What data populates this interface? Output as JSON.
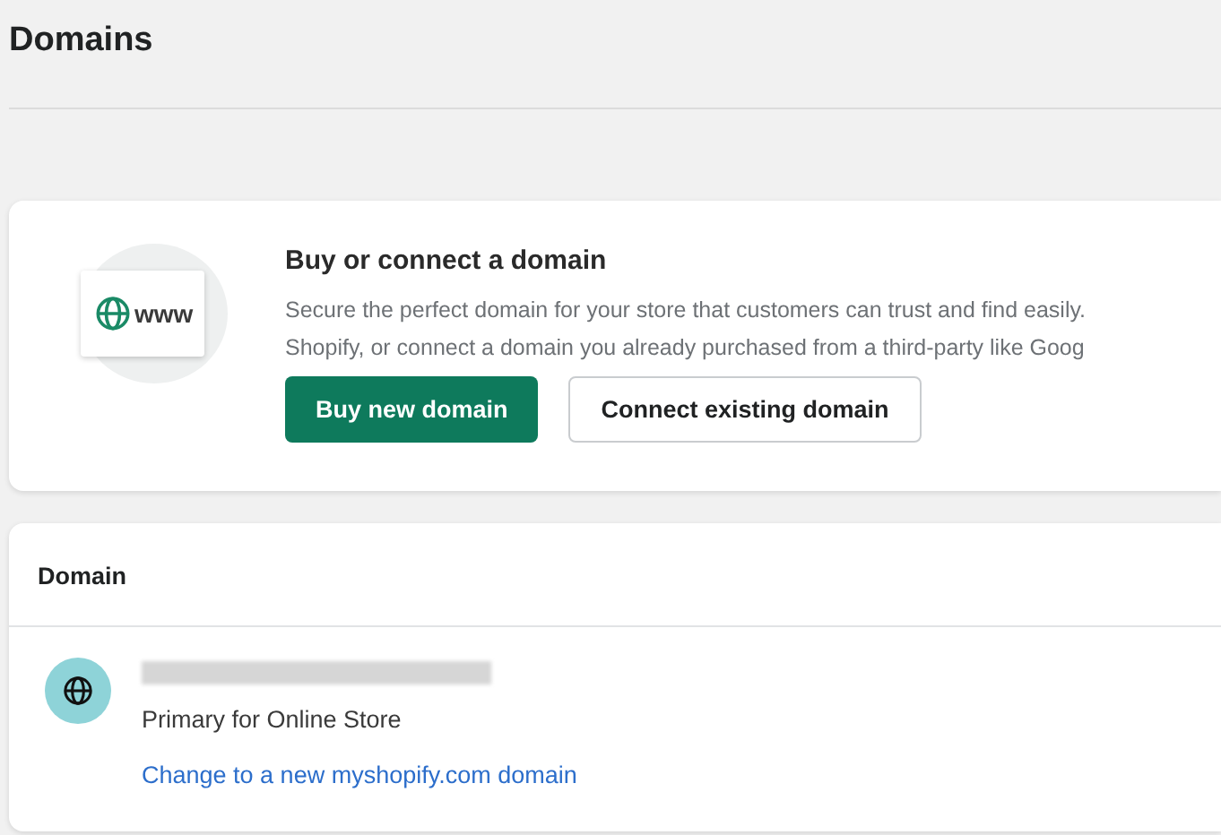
{
  "page": {
    "title": "Domains"
  },
  "promo_card": {
    "badge": "www",
    "title": "Buy or connect a domain",
    "description": [
      "Secure the perfect domain for your store that customers can trust and find easily.",
      "Shopify, or connect a domain you already purchased from a third-party like Goog"
    ],
    "buttons": [
      {
        "label": "Buy new domain",
        "kind": "primary"
      },
      {
        "label": "Connect existing domain",
        "kind": "secondary"
      }
    ]
  },
  "domain_card": {
    "heading": "Domain",
    "rows": [
      {
        "subtitle": "Primary for Online Store",
        "link": "Change to a new myshopify.com domain"
      }
    ]
  }
}
